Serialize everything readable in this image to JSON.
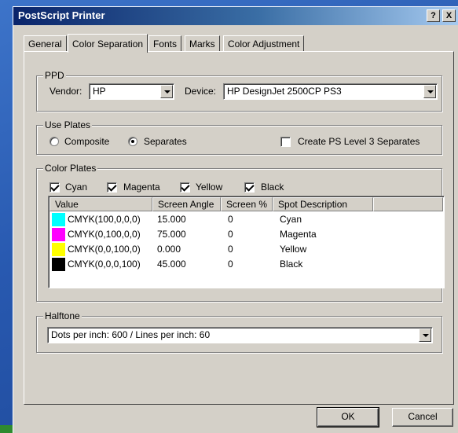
{
  "window": {
    "title": "PostScript Printer",
    "help_button": "?",
    "close_button": "X"
  },
  "tabs": [
    {
      "label": "General",
      "active": false
    },
    {
      "label": "Color Separation",
      "active": true
    },
    {
      "label": "Fonts",
      "active": false
    },
    {
      "label": "Marks",
      "active": false
    },
    {
      "label": "Color Adjustment",
      "active": false
    }
  ],
  "ppd": {
    "group_label": "PPD",
    "vendor_label": "Vendor:",
    "vendor_value": "HP",
    "device_label": "Device:",
    "device_value": "HP DesignJet 2500CP PS3"
  },
  "use_plates": {
    "group_label": "Use Plates",
    "composite_label": "Composite",
    "composite_selected": false,
    "separates_label": "Separates",
    "separates_selected": true,
    "level3_label": "Create PS Level 3 Separates",
    "level3_checked": false
  },
  "color_plates": {
    "group_label": "Color Plates",
    "checks": [
      {
        "label": "Cyan",
        "checked": true
      },
      {
        "label": "Magenta",
        "checked": true
      },
      {
        "label": "Yellow",
        "checked": true
      },
      {
        "label": "Black",
        "checked": true
      }
    ],
    "columns": [
      "Value",
      "Screen Angle",
      "Screen %",
      "Spot Description"
    ],
    "rows": [
      {
        "color": "#00ffff",
        "value": "CMYK(100,0,0,0)",
        "angle": "15.000",
        "screen": "0",
        "spot": "Cyan"
      },
      {
        "color": "#ff00ff",
        "value": "CMYK(0,100,0,0)",
        "angle": "75.000",
        "screen": "0",
        "spot": "Magenta"
      },
      {
        "color": "#ffff00",
        "value": "CMYK(0,0,100,0)",
        "angle": "0.000",
        "screen": "0",
        "spot": "Yellow"
      },
      {
        "color": "#000000",
        "value": "CMYK(0,0,0,100)",
        "angle": "45.000",
        "screen": "0",
        "spot": "Black"
      }
    ]
  },
  "halftone": {
    "group_label": "Halftone",
    "value": "Dots per inch: 600 / Lines per inch: 60"
  },
  "buttons": {
    "ok": "OK",
    "cancel": "Cancel"
  }
}
